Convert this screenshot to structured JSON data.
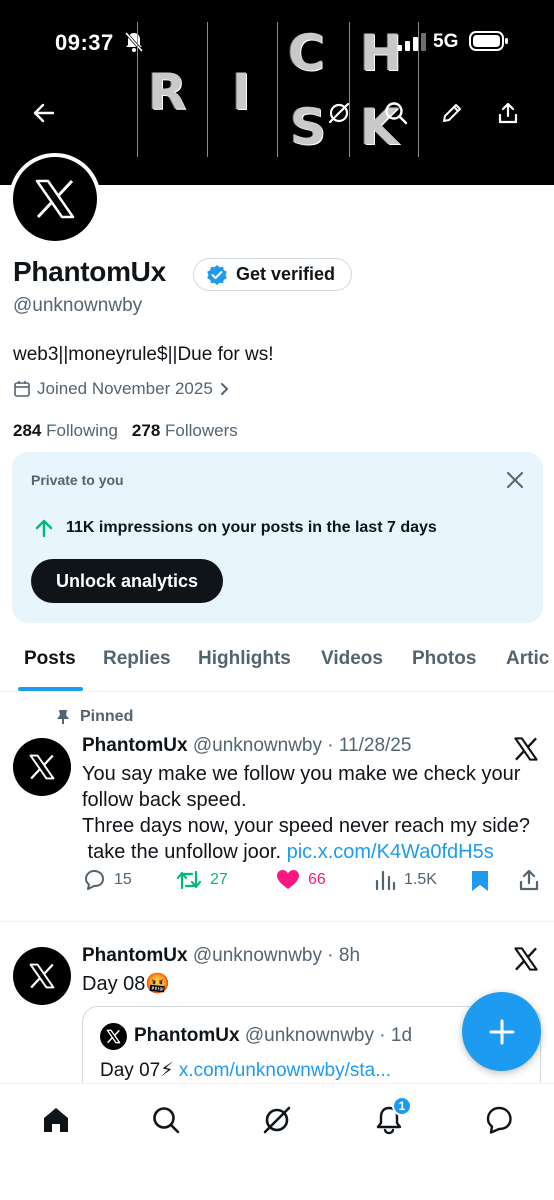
{
  "status_bar": {
    "time": "09:37",
    "network": "5G",
    "icons": [
      "bell-muted-icon",
      "signal-icon",
      "battery-icon"
    ]
  },
  "banner": {
    "letters": [
      "R",
      "I",
      "C",
      "H",
      "S",
      "K"
    ],
    "buttons": [
      "back-arrow-icon",
      "grok-icon",
      "search-icon",
      "edit-pencil-icon",
      "share-icon"
    ]
  },
  "profile": {
    "display_name": "PhantomUx",
    "verify_label": "Get verified",
    "handle": "@unknownwby",
    "bio": "web3||moneyrule$||Due for ws!",
    "joined": "Joined November 2025",
    "following_count": "284",
    "following_label": "Following",
    "followers_count": "278",
    "followers_label": "Followers"
  },
  "analytics_card": {
    "title": "Private to you",
    "impressions_text": "11K impressions on your posts in the last 7 days",
    "button_label": "Unlock analytics"
  },
  "tabs": [
    {
      "label": "Posts",
      "active": true
    },
    {
      "label": "Replies",
      "active": false
    },
    {
      "label": "Highlights",
      "active": false
    },
    {
      "label": "Videos",
      "active": false
    },
    {
      "label": "Photos",
      "active": false
    },
    {
      "label": "Artic",
      "active": false
    }
  ],
  "posts": [
    {
      "pinned_label": "Pinned",
      "name": "PhantomUx",
      "meta": "@unknownwby · 11/28/25",
      "lines": [
        "You say make we follow you make we check your",
        "follow back speed.",
        "Three days now, your speed never reach my side?",
        " take the unfollow joor. "
      ],
      "link": "pic.x.com/K4Wa0fdH5s",
      "stats": {
        "replies": "15",
        "reposts": "27",
        "likes": "66",
        "views": "1.5K"
      }
    },
    {
      "name": "PhantomUx",
      "meta": "@unknownwby · 8h",
      "text": "Day 08🤬",
      "quote": {
        "name": "PhantomUx",
        "meta": "@unknownwby · 1d",
        "text": "Day 07⚡ ",
        "link": "x.com/unknownwby/sta..."
      }
    }
  ],
  "bottom_nav": {
    "items": [
      "home-icon",
      "search-icon",
      "grok-icon",
      "notifications-icon",
      "messages-icon"
    ],
    "notification_badge": "1"
  },
  "colors": {
    "accent": "#1d9bf0",
    "text": "#0f1419",
    "secondary": "#536471",
    "repost": "#00ba7c",
    "like": "#f91880",
    "card_bg": "#e8f5fd"
  }
}
